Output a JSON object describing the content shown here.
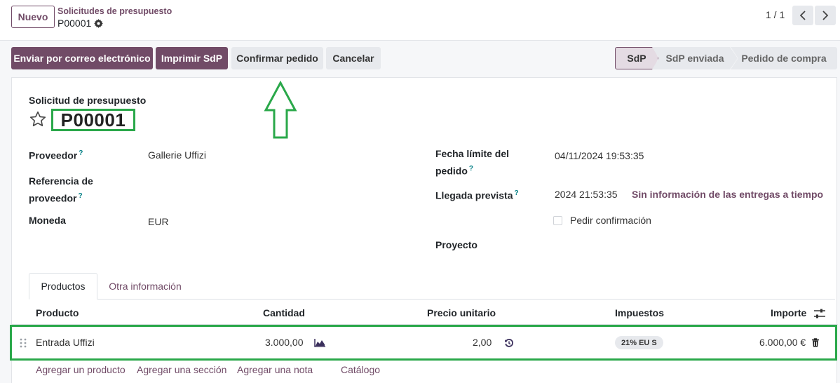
{
  "header": {
    "new_button": "Nuevo",
    "breadcrumb_parent": "Solicitudes de presupuesto",
    "breadcrumb_current": "P00001",
    "pager": "1 / 1"
  },
  "actions": {
    "send_email": "Enviar por correo electrónico",
    "print": "Imprimir SdP",
    "confirm": "Confirmar pedido",
    "cancel": "Cancelar"
  },
  "statusbar": [
    "SdP",
    "SdP enviada",
    "Pedido de compra"
  ],
  "record": {
    "label": "Solicitud de presupuesto",
    "name": "P00001"
  },
  "fields": {
    "vendor_label": "Proveedor",
    "vendor_value": "Gallerie Uffizi",
    "vendor_ref_label_1": "Referencia de",
    "vendor_ref_label_2": "proveedor",
    "currency_label": "Moneda",
    "currency_value": "EUR",
    "deadline_label_1": "Fecha límite del",
    "deadline_label_2": "pedido",
    "deadline_value": "04/11/2024 19:53:35",
    "expected_label": "Llegada prevista",
    "expected_value": "2024 21:53:35",
    "expected_link": "Sin información de las entregas a tiempo",
    "ask_confirmation": "Pedir confirmación",
    "project_label": "Proyecto",
    "help_mark": "?"
  },
  "tabs": [
    "Productos",
    "Otra información"
  ],
  "table": {
    "headers": [
      "Producto",
      "Cantidad",
      "Precio unitario",
      "Impuestos",
      "Importe"
    ],
    "rows": [
      {
        "product": "Entrada Uffizi",
        "qty": "3.000,00",
        "price": "2,00",
        "tax": "21% EU S",
        "amount": "6.000,00 €"
      }
    ]
  },
  "add_links": [
    "Agregar un producto",
    "Agregar una sección",
    "Agregar una nota",
    "Catálogo"
  ],
  "colors": {
    "brand": "#714b67",
    "highlight": "#2aa84a",
    "help": "#017e84"
  }
}
